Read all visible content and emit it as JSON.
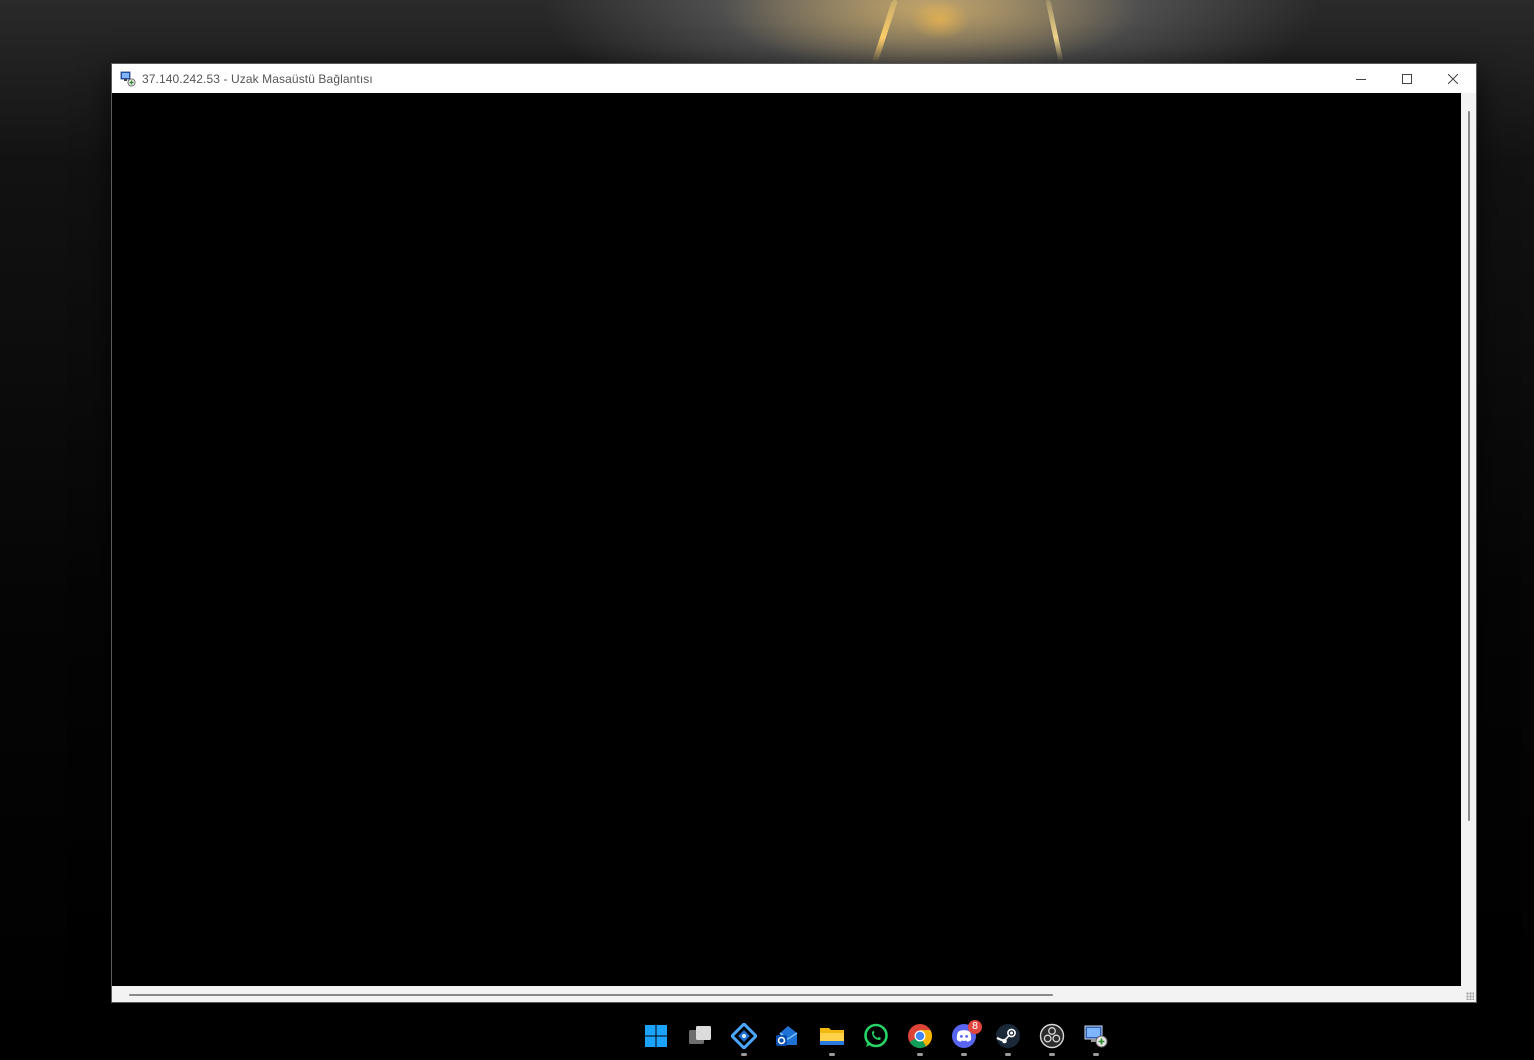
{
  "window": {
    "title": "37.140.242.53 - Uzak Masaüstü Bağlantısı",
    "icon": "remote-desktop-icon",
    "controls": [
      "minimize-icon",
      "maximize-icon",
      "close-icon"
    ]
  },
  "remote_session": {
    "background": "#000000"
  },
  "taskbar": {
    "items": [
      {
        "name": "start",
        "icon": "windows-logo-icon",
        "running": false
      },
      {
        "name": "task-view",
        "icon": "task-view-icon",
        "running": false
      },
      {
        "name": "dev-app",
        "icon": "blue-diamond-app-icon",
        "running": true
      },
      {
        "name": "outlook",
        "icon": "outlook-icon",
        "running": false
      },
      {
        "name": "file-explorer",
        "icon": "folder-icon",
        "running": true
      },
      {
        "name": "whatsapp",
        "icon": "whatsapp-icon",
        "running": false
      },
      {
        "name": "chrome",
        "icon": "chrome-icon",
        "running": true
      },
      {
        "name": "discord",
        "icon": "discord-icon",
        "running": true,
        "badge": "8"
      },
      {
        "name": "steam",
        "icon": "steam-icon",
        "running": true
      },
      {
        "name": "obs",
        "icon": "obs-icon",
        "running": true
      },
      {
        "name": "remote-desktop",
        "icon": "remote-desktop-icon",
        "running": true
      }
    ]
  },
  "colors": {
    "titlebar": "#ffffff",
    "window_frame": "#f3f3f3",
    "badge": "#e0463e",
    "windows_blue": "#1aa3ff"
  }
}
